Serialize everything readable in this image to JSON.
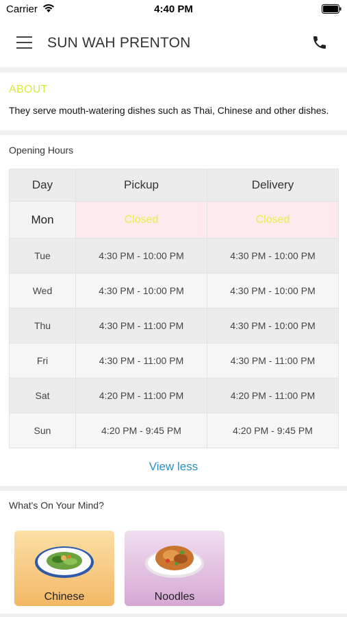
{
  "status_bar": {
    "carrier": "Carrier",
    "time": "4:40 PM"
  },
  "header": {
    "title": "SUN WAH PRENTON"
  },
  "about": {
    "title": "ABOUT",
    "text": "They serve mouth-watering dishes such as Thai, Chinese and other dishes.",
    "title_color": "#d7ec3c"
  },
  "opening_hours": {
    "title": "Opening Hours",
    "columns": [
      "Day",
      "Pickup",
      "Delivery"
    ],
    "rows": [
      {
        "day": "Mon",
        "pickup": "Closed",
        "delivery": "Closed"
      },
      {
        "day": "Tue",
        "pickup": "4:30 PM - 10:00 PM",
        "delivery": "4:30 PM - 10:00 PM"
      },
      {
        "day": "Wed",
        "pickup": "4:30 PM - 10:00 PM",
        "delivery": "4:30 PM - 10:00 PM"
      },
      {
        "day": "Thu",
        "pickup": "4:30 PM - 11:00 PM",
        "delivery": "4:30 PM - 10:00 PM"
      },
      {
        "day": "Fri",
        "pickup": "4:30 PM - 11:00 PM",
        "delivery": "4:30 PM - 11:00 PM"
      },
      {
        "day": "Sat",
        "pickup": "4:20 PM - 11:00 PM",
        "delivery": "4:20 PM - 11:00 PM"
      },
      {
        "day": "Sun",
        "pickup": "4:20 PM - 9:45 PM",
        "delivery": "4:20 PM - 9:45 PM"
      }
    ],
    "closed_color": "#e4f146",
    "view_less": "View less",
    "link_color": "#2b8fc0"
  },
  "mind": {
    "title": "What's On Your Mind?",
    "categories": [
      {
        "label": "Chinese",
        "icon": "chinese-dish-icon"
      },
      {
        "label": "Noodles",
        "icon": "noodles-dish-icon"
      }
    ]
  },
  "icons": {
    "menu": "menu-icon",
    "phone": "phone-icon",
    "wifi": "wifi-icon",
    "battery": "battery-icon"
  }
}
